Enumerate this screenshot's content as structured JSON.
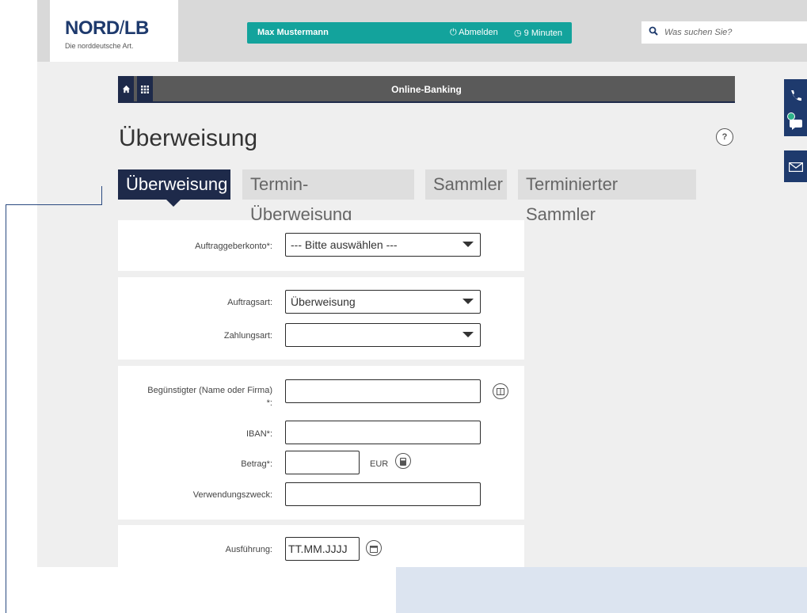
{
  "header": {
    "logo_main": "NORD",
    "logo_slash": "/",
    "logo_suffix": "LB",
    "logo_tagline": "Die norddeutsche Art.",
    "user_name": "Max Mustermann",
    "logout_label": "Abmelden",
    "session_timer": "9 Minuten",
    "search_placeholder": "Was suchen Sie?"
  },
  "nav": {
    "title": "Online-Banking"
  },
  "page": {
    "title": "Überweisung",
    "help_label": "?"
  },
  "tabs": [
    {
      "label": "Überweisung",
      "active": true
    },
    {
      "label": "Termin-Überweisung",
      "active": false
    },
    {
      "label": "Sammler",
      "active": false
    },
    {
      "label": "Terminierter Sammler",
      "active": false
    }
  ],
  "form": {
    "auftraggeberkonto_label": "Auftraggeberkonto*:",
    "auftraggeberkonto_value": "--- Bitte auswählen ---",
    "auftragsart_label": "Auftragsart:",
    "auftragsart_value": "Überweisung",
    "zahlungsart_label": "Zahlungsart:",
    "zahlungsart_value": "",
    "beguenstigter_label": "Begünstigter (Name oder Firma)",
    "beguenstigter_label_star": "*:",
    "beguenstigter_value": "",
    "iban_label": "IBAN*:",
    "iban_value": "",
    "betrag_label": "Betrag*:",
    "betrag_value": "",
    "currency": "EUR",
    "verwendungszweck_label": "Verwendungszweck:",
    "verwendungszweck_value": "",
    "ausfuehrung_label": "Ausführung:",
    "ausfuehrung_value": "TT.MM.JJJJ"
  },
  "icons": {
    "logout": "power-icon",
    "timer": "clock-icon",
    "search": "search-icon",
    "home": "home-icon",
    "apps": "grid-icon",
    "help": "help-icon",
    "address_book": "address-book-icon",
    "calculator": "calculator-icon",
    "calendar": "calendar-icon",
    "phone": "phone-icon",
    "chat": "chat-icon",
    "mail": "mail-icon"
  },
  "colors": {
    "brand_navy": "#1e2a4a",
    "accent_teal": "#13a39c",
    "presence_green": "#2db38a"
  }
}
